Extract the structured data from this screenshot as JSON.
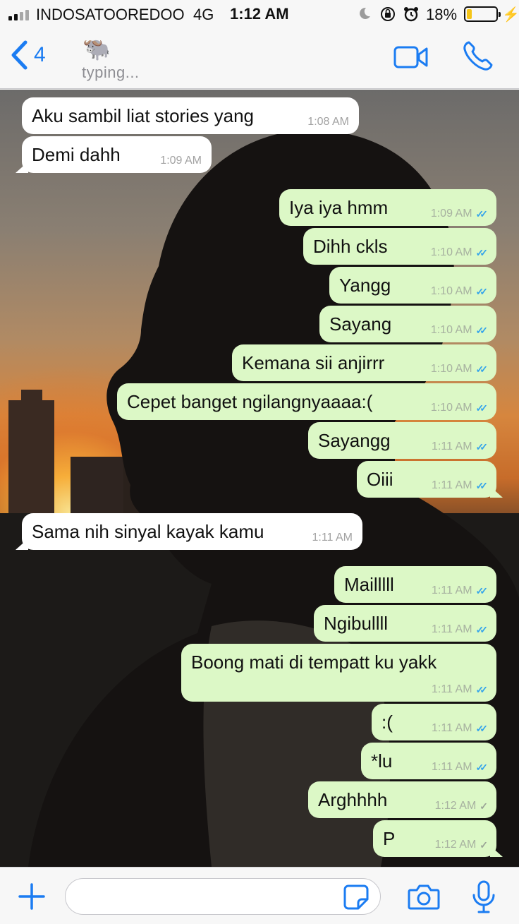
{
  "status_bar": {
    "carrier": "INDOSATOOREDOO",
    "network": "4G",
    "time": "1:12 AM",
    "battery_percent": "18%",
    "battery_level": 0.18
  },
  "header": {
    "back_count": "4",
    "contact_name": "🐃",
    "contact_status": "typing..."
  },
  "messages": [
    {
      "dir": "in",
      "text": "Aku sambil liat stories yang",
      "time": "1:08 AM"
    },
    {
      "dir": "in",
      "text": "Demi dahh",
      "time": "1:09 AM"
    },
    {
      "dir": "out",
      "text": "Iya iya hmm",
      "time": "1:09 AM",
      "read": true
    },
    {
      "dir": "out",
      "text": "Dihh ckls",
      "time": "1:10 AM",
      "read": true
    },
    {
      "dir": "out",
      "text": "Yangg",
      "time": "1:10 AM",
      "read": true
    },
    {
      "dir": "out",
      "text": "Sayang",
      "time": "1:10 AM",
      "read": true
    },
    {
      "dir": "out",
      "text": "Kemana sii anjirrr",
      "time": "1:10 AM",
      "read": true
    },
    {
      "dir": "out",
      "text": "Cepet banget ngilangnyaaaa:(",
      "time": "1:10 AM",
      "read": true
    },
    {
      "dir": "out",
      "text": "Sayangg",
      "time": "1:11 AM",
      "read": true
    },
    {
      "dir": "out",
      "text": "Oiii",
      "time": "1:11 AM",
      "read": true
    },
    {
      "dir": "in",
      "text": "Sama nih sinyal kayak kamu",
      "time": "1:11 AM"
    },
    {
      "dir": "out",
      "text": "Mailllll",
      "time": "1:11 AM",
      "read": true
    },
    {
      "dir": "out",
      "text": "Ngibullll",
      "time": "1:11 AM",
      "read": true
    },
    {
      "dir": "out",
      "text": "Boong mati di tempatt ku yakk",
      "time": "1:11 AM",
      "read": true
    },
    {
      "dir": "out",
      "text": ":(",
      "time": "1:11 AM",
      "read": true
    },
    {
      "dir": "out",
      "text": "*lu",
      "time": "1:11 AM",
      "read": true
    },
    {
      "dir": "out",
      "text": "Arghhhh",
      "time": "1:12 AM",
      "read": false
    },
    {
      "dir": "out",
      "text": "P",
      "time": "1:12 AM",
      "read": false
    }
  ],
  "input": {
    "value": "",
    "placeholder": ""
  },
  "colors": {
    "accent": "#1b7cf2",
    "outgoing_bubble": "#dcf8c6",
    "incoming_bubble": "#ffffff",
    "read_tick": "#34a4eb",
    "battery_fill": "#f5c518"
  },
  "icons": {
    "back": "chevron-left-icon",
    "video": "video-camera-icon",
    "call": "phone-icon",
    "plus": "plus-icon",
    "sticker": "sticker-icon",
    "camera": "camera-icon",
    "mic": "microphone-icon"
  }
}
